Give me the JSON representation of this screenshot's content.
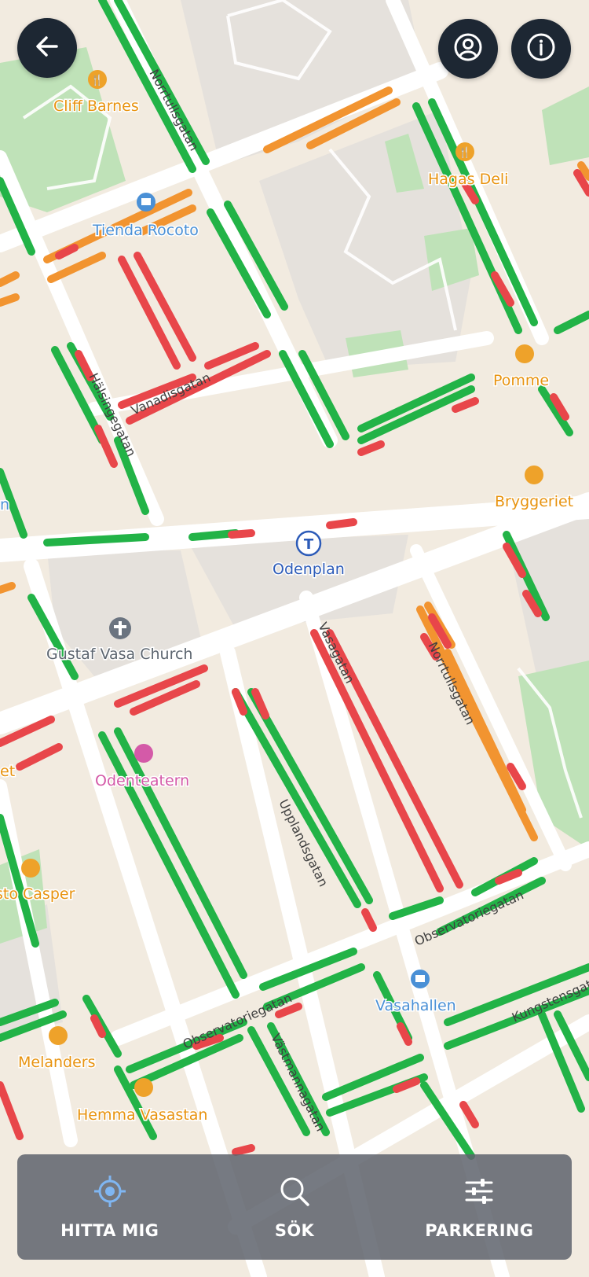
{
  "map": {
    "pois": [
      {
        "name": "Cliff Barnes",
        "icon": "restaurant-icon",
        "color": "#e8930f"
      },
      {
        "name": "Hagas Deli",
        "icon": "restaurant-icon",
        "color": "#e8930f"
      },
      {
        "name": "Tienda Rocoto",
        "icon": "shop-icon",
        "color": "#4a90d6"
      },
      {
        "name": "Pomme",
        "icon": "restaurant-icon",
        "color": "#e8930f"
      },
      {
        "name": "Bryggeriet",
        "icon": "restaurant-icon",
        "color": "#e8930f"
      },
      {
        "name": "Odenplan",
        "icon": "metro-icon",
        "color": "#2c5bb8"
      },
      {
        "name": "Gustaf Vasa Church",
        "icon": "church-icon",
        "color": "#6b7480"
      },
      {
        "name": "Odenteatern",
        "icon": "theatre-icon",
        "color": "#d45aa8"
      },
      {
        "name": "sto Casper",
        "icon": "restaurant-icon",
        "color": "#e8930f"
      },
      {
        "name": "Melanders",
        "icon": "restaurant-icon",
        "color": "#e8930f"
      },
      {
        "name": "Hemma Vasastan",
        "icon": "restaurant-icon",
        "color": "#e8930f"
      },
      {
        "name": "Vasahallen",
        "icon": "shop-icon",
        "color": "#4a90d6"
      },
      {
        "name": "Bryggeriet",
        "icon": "restaurant-icon",
        "color": "#e8930f"
      }
    ],
    "streets": [
      "Norrtullsgatan",
      "Vanadisgatan",
      "Hälsingegatan",
      "Upplandsgatan",
      "Observatoriegatan",
      "Vasagatan",
      "Vanadisvägen",
      "Norrtullsgatan",
      "Västmannagatan",
      "Kungstensgatan"
    ],
    "edge_labels": [
      "et",
      "n"
    ],
    "parking_colors": {
      "available": "#22b347",
      "limited": "#f29430",
      "unavailable": "#e8464a"
    }
  },
  "header": {
    "back_icon": "arrow-left-icon",
    "account_icon": "user-icon",
    "info_icon": "info-icon"
  },
  "bottom_nav": {
    "find_me": {
      "label": "HITTA MIG",
      "icon": "locate-icon"
    },
    "search": {
      "label": "SÖK",
      "icon": "search-icon"
    },
    "parking": {
      "label": "PARKERING",
      "icon": "sliders-icon"
    }
  }
}
